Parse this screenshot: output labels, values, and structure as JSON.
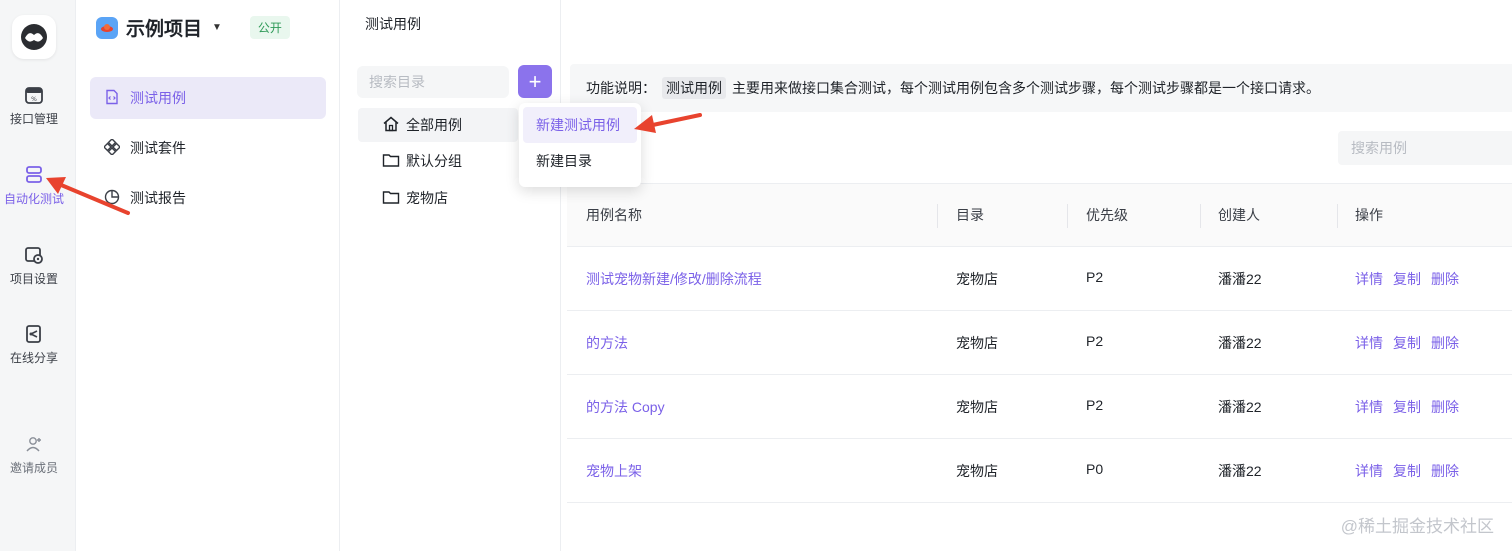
{
  "rail": {
    "items": [
      {
        "label": "接口管理",
        "icon": "calendar-api-icon"
      },
      {
        "label": "自动化测试",
        "icon": "layers-icon",
        "active": true
      },
      {
        "label": "项目设置",
        "icon": "settings-icon"
      },
      {
        "label": "在线分享",
        "icon": "share-icon"
      }
    ],
    "invite_label": "邀请成员"
  },
  "project": {
    "name": "示例项目",
    "badge": "公开"
  },
  "nav": {
    "items": [
      {
        "label": "测试用例",
        "icon": "file-code-icon",
        "active": true
      },
      {
        "label": "测试套件",
        "icon": "suite-icon"
      },
      {
        "label": "测试报告",
        "icon": "pie-chart-icon"
      }
    ]
  },
  "page_title": "测试用例",
  "tree": {
    "search_placeholder": "搜索目录",
    "items": [
      {
        "label": "全部用例",
        "icon": "home-icon"
      },
      {
        "label": "默认分组",
        "icon": "folder-icon"
      },
      {
        "label": "宠物店",
        "icon": "folder-icon"
      }
    ]
  },
  "dropdown": {
    "items": [
      "新建测试用例",
      "新建目录"
    ]
  },
  "description": {
    "prefix": "功能说明：",
    "code": "测试用例",
    "text": "主要用来做接口集合测试，每个测试用例包含多个测试步骤，每个测试步骤都是一个接口请求。"
  },
  "case_search_placeholder": "搜索用例",
  "table": {
    "headers": [
      "用例名称",
      "目录",
      "优先级",
      "创建人",
      "操作"
    ],
    "rows": [
      {
        "name": "测试宠物新建/修改/删除流程",
        "dir": "宠物店",
        "priority": "P2",
        "creator": "潘潘22"
      },
      {
        "name": "的方法",
        "dir": "宠物店",
        "priority": "P2",
        "creator": "潘潘22"
      },
      {
        "name": "的方法 Copy",
        "dir": "宠物店",
        "priority": "P2",
        "creator": "潘潘22"
      },
      {
        "name": "宠物上架",
        "dir": "宠物店",
        "priority": "P0",
        "creator": "潘潘22"
      }
    ],
    "actions": [
      "详情",
      "复制",
      "删除"
    ]
  },
  "watermark": "@稀土掘金技术社区",
  "colors": {
    "accent": "#7b61e8",
    "arrow": "#e8432e"
  }
}
